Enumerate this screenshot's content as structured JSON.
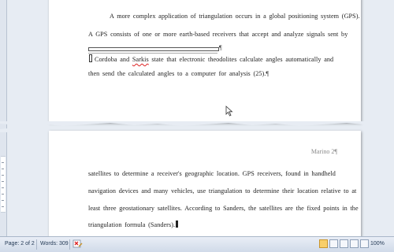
{
  "page1": {
    "line1": "A more complex application of triangulation occurs in a global positioning system (GPS).",
    "line2": "A GPS consists of one or more earth-based receivers that accept and analyze signals sent by",
    "field_pilcrow": "¶",
    "line3_pre": "Cordoba and ",
    "line3_misspelled": "Sarkis",
    "line3_post": " state that electronic theodolites calculate angles automatically and",
    "line4": "then send the calculated angles to a computer for analysis (25).",
    "pilcrow": "¶"
  },
  "page2": {
    "header": "Marino 2¶",
    "line1": "satellites to determine a receiver's geographic location. GPS receivers, found in handheld",
    "line2": "navigation devices and many vehicles, use triangulation to determine their location relative to at",
    "line3": "least three geostationary satellites. According to Sanders, the satellites are the fixed points in the",
    "line4": "triangulation formula (Sanders)."
  },
  "statusbar": {
    "page": "Page: 2 of 2",
    "words": "Words: 309",
    "zoom": "100%",
    "zoom_minus": "−",
    "zoom_plus": "+",
    "zoom_percent": 100
  },
  "colors": {
    "active_view": "#f8cf6a",
    "statusbar_text": "#243a56"
  }
}
